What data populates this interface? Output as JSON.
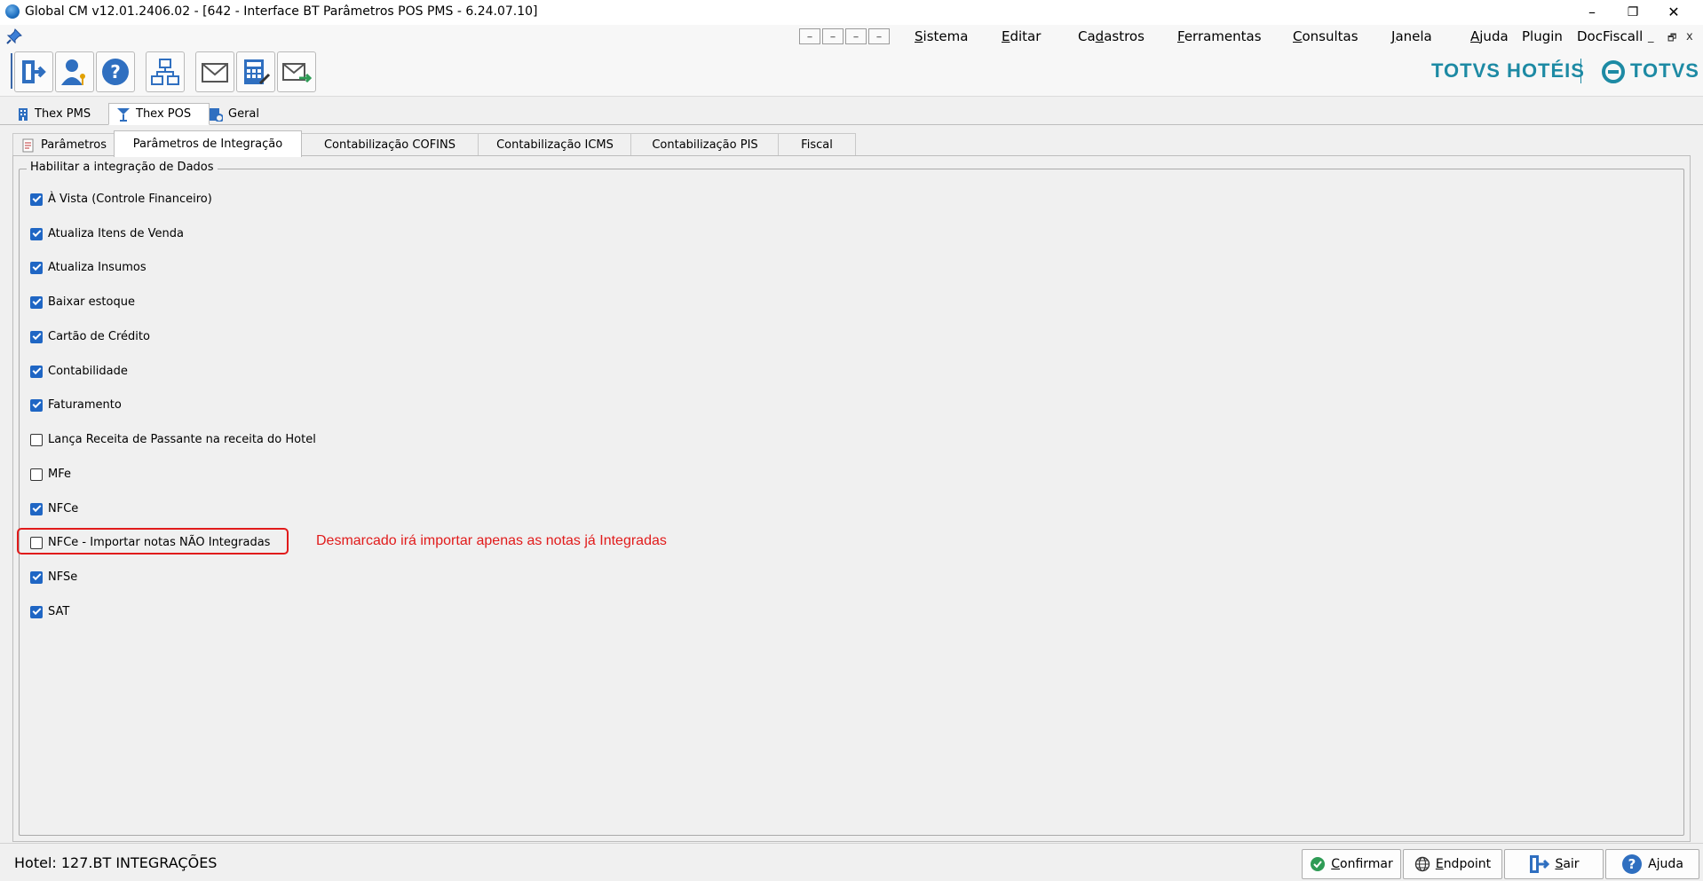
{
  "window": {
    "title": "Global CM v12.01.2406.02 - [642 - Interface BT Parâmetros POS PMS - 6.24.07.10]",
    "minimize": "–",
    "maximize": "❐",
    "close": "✕"
  },
  "menu": {
    "mdi_buttons": [
      "_",
      "_",
      "_",
      "_"
    ],
    "items": [
      {
        "pre": "",
        "u": "S",
        "post": "istema"
      },
      {
        "pre": "",
        "u": "E",
        "post": "ditar"
      },
      {
        "pre": "Ca",
        "u": "d",
        "post": "astros"
      },
      {
        "pre": "",
        "u": "F",
        "post": "erramentas"
      },
      {
        "pre": "",
        "u": "C",
        "post": "onsultas"
      },
      {
        "pre": "",
        "u": "J",
        "post": "anela"
      },
      {
        "pre": "",
        "u": "A",
        "post": "juda"
      },
      {
        "pre": "Plugin",
        "u": "",
        "post": ""
      },
      {
        "pre": "DocFiscall",
        "u": "",
        "post": ""
      }
    ],
    "child_minimize": "_",
    "child_restore": "🗗",
    "child_close": "x"
  },
  "toolbar": {
    "buttons": [
      "exit-icon",
      "user-key-icon",
      "help-icon",
      "hierarchy-icon",
      "mail-icon",
      "calculator-icon",
      "mail-forward-icon"
    ],
    "brand_left": "TOTVS HOTÉIS",
    "brand_right": "TOTVS"
  },
  "top_tabs": [
    {
      "label": "Thex PMS",
      "icon": "building-icon",
      "active": false
    },
    {
      "label": "Thex POS",
      "icon": "cocktail-icon",
      "active": true
    },
    {
      "label": "Geral",
      "icon": "settings-doc-icon",
      "active": false
    }
  ],
  "sub_tabs": [
    {
      "label": "Parâmetros",
      "active": false
    },
    {
      "label": "Parâmetros de Integração",
      "active": true
    },
    {
      "label": "Contabilização COFINS",
      "active": false
    },
    {
      "label": "Contabilização ICMS",
      "active": false
    },
    {
      "label": "Contabilização PIS",
      "active": false
    },
    {
      "label": "Fiscal",
      "active": false
    }
  ],
  "group": {
    "legend": "Habilitar a integração de Dados",
    "options": [
      {
        "label": "À Vista (Controle Financeiro)",
        "checked": true
      },
      {
        "label": "Atualiza Itens de Venda",
        "checked": true
      },
      {
        "label": "Atualiza Insumos",
        "checked": true
      },
      {
        "label": "Baixar estoque",
        "checked": true
      },
      {
        "label": "Cartão de Crédito",
        "checked": true
      },
      {
        "label": "Contabilidade",
        "checked": true
      },
      {
        "label": "Faturamento",
        "checked": true
      },
      {
        "label": "Lança Receita de Passante na receita do Hotel",
        "checked": false
      },
      {
        "label": "MFe",
        "checked": false
      },
      {
        "label": "NFCe",
        "checked": true
      },
      {
        "label": "NFCe - Importar notas NÃO Integradas",
        "checked": false
      },
      {
        "label": "NFSe",
        "checked": true
      },
      {
        "label": "SAT",
        "checked": true
      }
    ],
    "annotation": "Desmarcado irá importar apenas as notas já Integradas"
  },
  "status": {
    "hotel": "Hotel: 127.BT INTEGRAÇÕES",
    "buttons": [
      {
        "u": "C",
        "rest": "onfirmar",
        "icon": "check-icon"
      },
      {
        "u": "E",
        "rest": "ndpoint",
        "icon": "globe-icon"
      },
      {
        "u": "S",
        "rest": "air",
        "icon": "exit-icon"
      },
      {
        "u": "",
        "rest": "Ajuda",
        "icon": "help-icon"
      }
    ]
  },
  "colors": {
    "brand": "#1d8aa4",
    "checkbox": "#1f66c4",
    "annotation": "#e11b1b"
  }
}
